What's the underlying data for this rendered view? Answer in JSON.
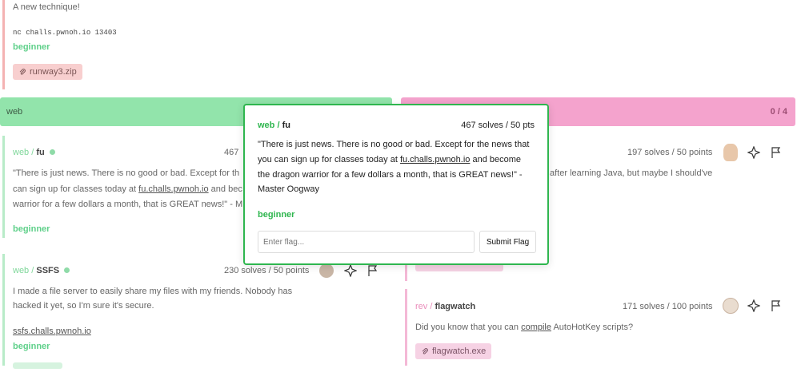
{
  "top_card": {
    "description": "A new technique!",
    "connection": "nc challs.pwnoh.io 13403",
    "difficulty": "beginner",
    "attachment": "runway3.zip"
  },
  "web_header": {
    "label": "web"
  },
  "rev_header": {
    "progress": "0 / 4"
  },
  "fu_card": {
    "category": "web",
    "separator": "/",
    "name": "fu",
    "solves_partial": "467",
    "description_lines": [
      "\"There is just news. There is no good or bad. Except for th",
      "can sign up for classes today at",
      "warrior for a few dollars a month, that is GREAT news!\" - M"
    ],
    "link": "fu.challs.pwnoh.io",
    "link_suffix": "and bec",
    "difficulty": "beginner"
  },
  "ssfs_card": {
    "category": "web",
    "separator": "/",
    "name": "SSFS",
    "stats": "230 solves / 50 points",
    "description_lines": [
      "I made a file server to easily share my files with my friends. Nobody has",
      "hacked it yet, so I'm sure it's secure."
    ],
    "link": "ssfs.challs.pwnoh.io",
    "difficulty": "beginner"
  },
  "right_card1": {
    "stats": "197 solves / 50 points",
    "description_partial": "after learning Java, but maybe I should've"
  },
  "flagwatch_card": {
    "category": "rev",
    "separator": "/",
    "name": "flagwatch",
    "stats": "171 solves / 100 points",
    "description_prefix": "Did you know that you can",
    "description_link": "compile",
    "description_suffix": "AutoHotKey scripts?",
    "attachment": "flagwatch.exe"
  },
  "modal": {
    "category": "web",
    "separator": "/",
    "name": "fu",
    "stats": "467 solves / 50 pts",
    "line1": "\"There is just news. There is no good or bad. Except for the news that",
    "line2_prefix": "you can sign up for classes today at",
    "line2_link": "fu.challs.pwnoh.io",
    "line2_suffix": "and become",
    "line3": "the dragon warrior for a few dollars a month, that is GREAT news!\" -",
    "line4": "Master Oogway",
    "difficulty": "beginner",
    "input_placeholder": "Enter flag...",
    "submit_label": "Submit Flag"
  },
  "colors": {
    "web_green": "#92e4ab",
    "rev_pink": "#f4a3cd",
    "modal_border": "#2fb64f",
    "attachment_red": "#f8cfcf",
    "attachment_pink": "#f6d2e4"
  },
  "icons": [
    "paperclip-icon",
    "hint-sparkle-icon",
    "flag-icon",
    "avatar"
  ]
}
